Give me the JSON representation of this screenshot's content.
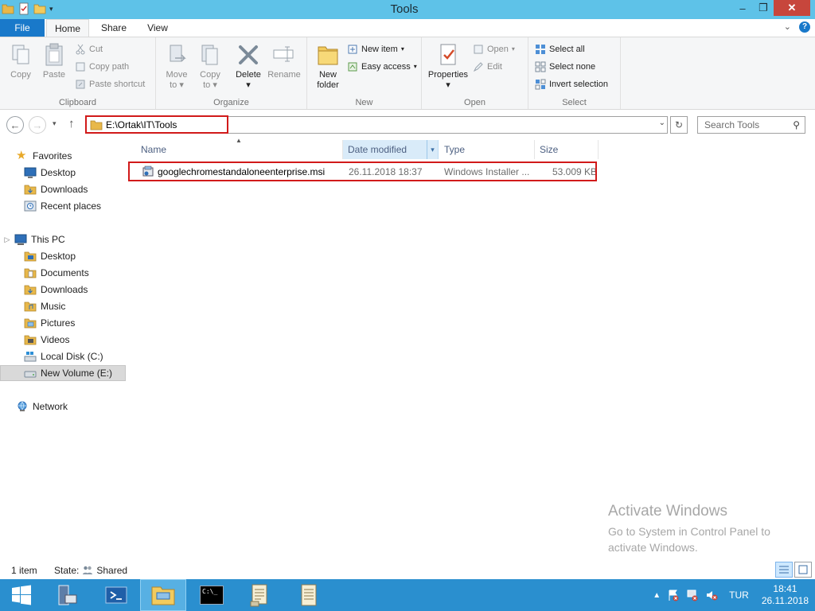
{
  "window": {
    "title": "Tools",
    "minimize": "–",
    "maximize": "❐",
    "close": "✕"
  },
  "ribbon_tabs": {
    "file": "File",
    "home": "Home",
    "share": "Share",
    "view": "View"
  },
  "ribbon": {
    "clipboard": {
      "label": "Clipboard",
      "copy": "Copy",
      "paste": "Paste",
      "cut": "Cut",
      "copy_path": "Copy path",
      "paste_shortcut": "Paste shortcut"
    },
    "organize": {
      "label": "Organize",
      "move_to_line1": "Move",
      "move_to_line2": "to",
      "copy_to_line1": "Copy",
      "copy_to_line2": "to",
      "delete": "Delete",
      "rename": "Rename"
    },
    "new": {
      "label": "New",
      "new_folder_line1": "New",
      "new_folder_line2": "folder",
      "new_item": "New item",
      "easy_access": "Easy access"
    },
    "open": {
      "label": "Open",
      "properties": "Properties",
      "open": "Open",
      "edit": "Edit"
    },
    "select": {
      "label": "Select",
      "select_all": "Select all",
      "select_none": "Select none",
      "invert_selection": "Invert selection"
    }
  },
  "address_bar": {
    "path": "E:\\Ortak\\IT\\Tools",
    "search_placeholder": "Search Tools"
  },
  "nav_pane": {
    "favorites": "Favorites",
    "fav_items": [
      "Desktop",
      "Downloads",
      "Recent places"
    ],
    "this_pc": "This PC",
    "pc_items": [
      "Desktop",
      "Documents",
      "Downloads",
      "Music",
      "Pictures",
      "Videos",
      "Local Disk (C:)",
      "New Volume (E:)"
    ],
    "network": "Network"
  },
  "columns": {
    "name": "Name",
    "date_modified": "Date modified",
    "type": "Type",
    "size": "Size"
  },
  "files": [
    {
      "name": "googlechromestandaloneenterprise.msi",
      "date_modified": "26.11.2018 18:37",
      "type": "Windows Installer ...",
      "size": "53.009 KB"
    }
  ],
  "status_bar": {
    "item_count": "1 item",
    "state_label": "State:",
    "state_value": "Shared"
  },
  "watermark": {
    "title": "Activate Windows",
    "line1": "Go to System in Control Panel to",
    "line2": "activate Windows."
  },
  "taskbar": {
    "cmd_label": "C:\\_",
    "language": "TUR",
    "time": "18:41",
    "date": "26.11.2018"
  },
  "colors": {
    "titlebar": "#5ec2e8",
    "file_tab": "#1979ca",
    "taskbar": "#2a8fcf",
    "highlight": "#d11a1a"
  }
}
